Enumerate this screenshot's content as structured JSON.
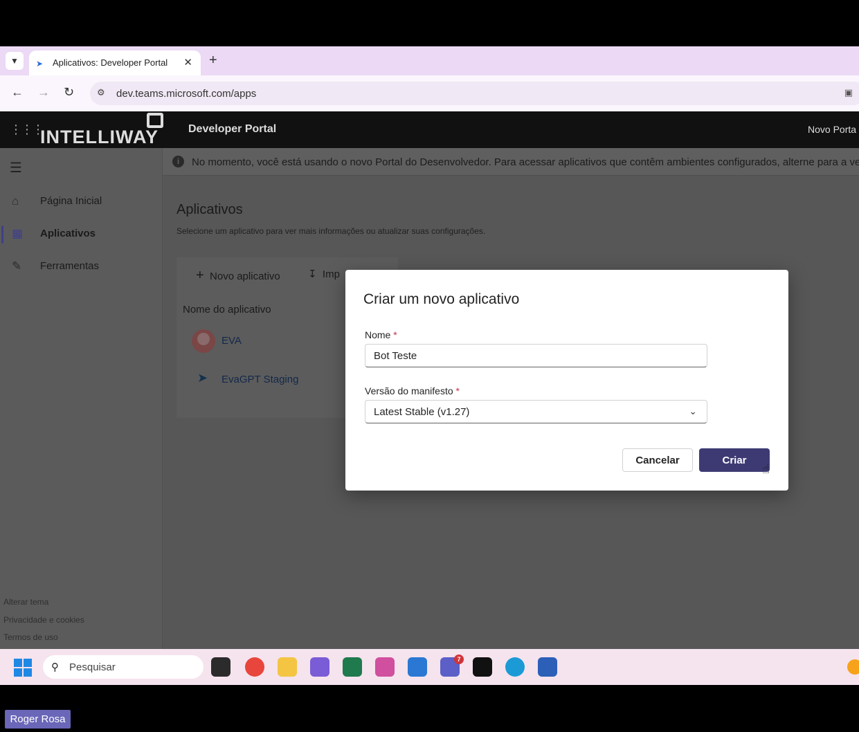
{
  "browser": {
    "tab_title": "Aplicativos: Developer Portal",
    "tab_close": "✕",
    "new_tab": "+",
    "url": "dev.teams.microsoft.com/apps"
  },
  "header": {
    "logo": "INTELLIWAY",
    "app_title": "Developer Portal",
    "right_link": "Novo Porta"
  },
  "sidebar": {
    "items": [
      {
        "label": "Página Inicial",
        "icon": "home-icon"
      },
      {
        "label": "Aplicativos",
        "icon": "apps-icon",
        "active": true
      },
      {
        "label": "Ferramentas",
        "icon": "pencil-icon"
      }
    ],
    "footer": [
      "Alterar tema",
      "Privacidade e cookies",
      "Termos de uso"
    ]
  },
  "main": {
    "banner": "No momento, você está usando o novo Portal do Desenvolvedor. Para acessar aplicativos que contêm ambientes configurados, alterne para a versã",
    "title": "Aplicativos",
    "subtitle": "Selecione um aplicativo para ver mais informações ou atualizar suas configurações.",
    "new_app_label": "Novo aplicativo",
    "import_label": "Imp",
    "column_header": "Nome do aplicativo",
    "apps": [
      "EVA",
      "EvaGPT Staging"
    ]
  },
  "modal": {
    "title": "Criar um novo aplicativo",
    "name_label": "Nome",
    "name_value": "Bot Teste",
    "manifest_label": "Versão do manifesto",
    "manifest_value": "Latest Stable (v1.27)",
    "required_mark": "*",
    "cancel_label": "Cancelar",
    "create_label": "Criar"
  },
  "taskbar": {
    "search_placeholder": "Pesquisar",
    "teams_badge": "7"
  },
  "presenter": "Roger Rosa",
  "colors": {
    "primary_button": "#3d3a73",
    "overlay": "#575757",
    "tab_strip": "#ebd9f5"
  }
}
